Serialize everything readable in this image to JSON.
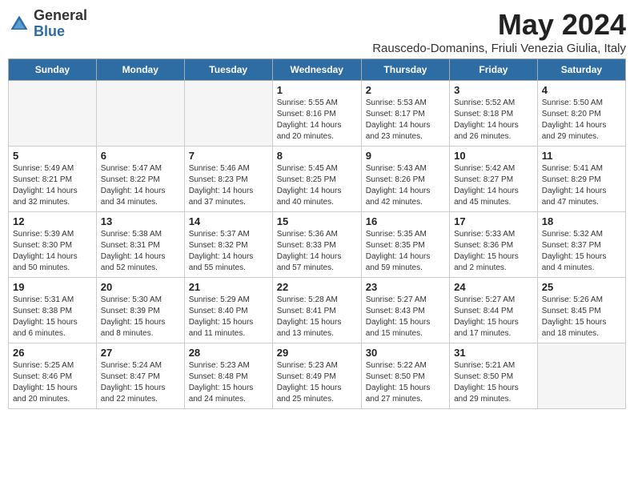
{
  "header": {
    "logo_general": "General",
    "logo_blue": "Blue",
    "month_year": "May 2024",
    "location": "Rauscedo-Domanins, Friuli Venezia Giulia, Italy"
  },
  "days_of_week": [
    "Sunday",
    "Monday",
    "Tuesday",
    "Wednesday",
    "Thursday",
    "Friday",
    "Saturday"
  ],
  "weeks": [
    [
      {
        "day": "",
        "info": ""
      },
      {
        "day": "",
        "info": ""
      },
      {
        "day": "",
        "info": ""
      },
      {
        "day": "1",
        "info": "Sunrise: 5:55 AM\nSunset: 8:16 PM\nDaylight: 14 hours\nand 20 minutes."
      },
      {
        "day": "2",
        "info": "Sunrise: 5:53 AM\nSunset: 8:17 PM\nDaylight: 14 hours\nand 23 minutes."
      },
      {
        "day": "3",
        "info": "Sunrise: 5:52 AM\nSunset: 8:18 PM\nDaylight: 14 hours\nand 26 minutes."
      },
      {
        "day": "4",
        "info": "Sunrise: 5:50 AM\nSunset: 8:20 PM\nDaylight: 14 hours\nand 29 minutes."
      }
    ],
    [
      {
        "day": "5",
        "info": "Sunrise: 5:49 AM\nSunset: 8:21 PM\nDaylight: 14 hours\nand 32 minutes."
      },
      {
        "day": "6",
        "info": "Sunrise: 5:47 AM\nSunset: 8:22 PM\nDaylight: 14 hours\nand 34 minutes."
      },
      {
        "day": "7",
        "info": "Sunrise: 5:46 AM\nSunset: 8:23 PM\nDaylight: 14 hours\nand 37 minutes."
      },
      {
        "day": "8",
        "info": "Sunrise: 5:45 AM\nSunset: 8:25 PM\nDaylight: 14 hours\nand 40 minutes."
      },
      {
        "day": "9",
        "info": "Sunrise: 5:43 AM\nSunset: 8:26 PM\nDaylight: 14 hours\nand 42 minutes."
      },
      {
        "day": "10",
        "info": "Sunrise: 5:42 AM\nSunset: 8:27 PM\nDaylight: 14 hours\nand 45 minutes."
      },
      {
        "day": "11",
        "info": "Sunrise: 5:41 AM\nSunset: 8:29 PM\nDaylight: 14 hours\nand 47 minutes."
      }
    ],
    [
      {
        "day": "12",
        "info": "Sunrise: 5:39 AM\nSunset: 8:30 PM\nDaylight: 14 hours\nand 50 minutes."
      },
      {
        "day": "13",
        "info": "Sunrise: 5:38 AM\nSunset: 8:31 PM\nDaylight: 14 hours\nand 52 minutes."
      },
      {
        "day": "14",
        "info": "Sunrise: 5:37 AM\nSunset: 8:32 PM\nDaylight: 14 hours\nand 55 minutes."
      },
      {
        "day": "15",
        "info": "Sunrise: 5:36 AM\nSunset: 8:33 PM\nDaylight: 14 hours\nand 57 minutes."
      },
      {
        "day": "16",
        "info": "Sunrise: 5:35 AM\nSunset: 8:35 PM\nDaylight: 14 hours\nand 59 minutes."
      },
      {
        "day": "17",
        "info": "Sunrise: 5:33 AM\nSunset: 8:36 PM\nDaylight: 15 hours\nand 2 minutes."
      },
      {
        "day": "18",
        "info": "Sunrise: 5:32 AM\nSunset: 8:37 PM\nDaylight: 15 hours\nand 4 minutes."
      }
    ],
    [
      {
        "day": "19",
        "info": "Sunrise: 5:31 AM\nSunset: 8:38 PM\nDaylight: 15 hours\nand 6 minutes."
      },
      {
        "day": "20",
        "info": "Sunrise: 5:30 AM\nSunset: 8:39 PM\nDaylight: 15 hours\nand 8 minutes."
      },
      {
        "day": "21",
        "info": "Sunrise: 5:29 AM\nSunset: 8:40 PM\nDaylight: 15 hours\nand 11 minutes."
      },
      {
        "day": "22",
        "info": "Sunrise: 5:28 AM\nSunset: 8:41 PM\nDaylight: 15 hours\nand 13 minutes."
      },
      {
        "day": "23",
        "info": "Sunrise: 5:27 AM\nSunset: 8:43 PM\nDaylight: 15 hours\nand 15 minutes."
      },
      {
        "day": "24",
        "info": "Sunrise: 5:27 AM\nSunset: 8:44 PM\nDaylight: 15 hours\nand 17 minutes."
      },
      {
        "day": "25",
        "info": "Sunrise: 5:26 AM\nSunset: 8:45 PM\nDaylight: 15 hours\nand 18 minutes."
      }
    ],
    [
      {
        "day": "26",
        "info": "Sunrise: 5:25 AM\nSunset: 8:46 PM\nDaylight: 15 hours\nand 20 minutes."
      },
      {
        "day": "27",
        "info": "Sunrise: 5:24 AM\nSunset: 8:47 PM\nDaylight: 15 hours\nand 22 minutes."
      },
      {
        "day": "28",
        "info": "Sunrise: 5:23 AM\nSunset: 8:48 PM\nDaylight: 15 hours\nand 24 minutes."
      },
      {
        "day": "29",
        "info": "Sunrise: 5:23 AM\nSunset: 8:49 PM\nDaylight: 15 hours\nand 25 minutes."
      },
      {
        "day": "30",
        "info": "Sunrise: 5:22 AM\nSunset: 8:50 PM\nDaylight: 15 hours\nand 27 minutes."
      },
      {
        "day": "31",
        "info": "Sunrise: 5:21 AM\nSunset: 8:50 PM\nDaylight: 15 hours\nand 29 minutes."
      },
      {
        "day": "",
        "info": ""
      }
    ]
  ]
}
